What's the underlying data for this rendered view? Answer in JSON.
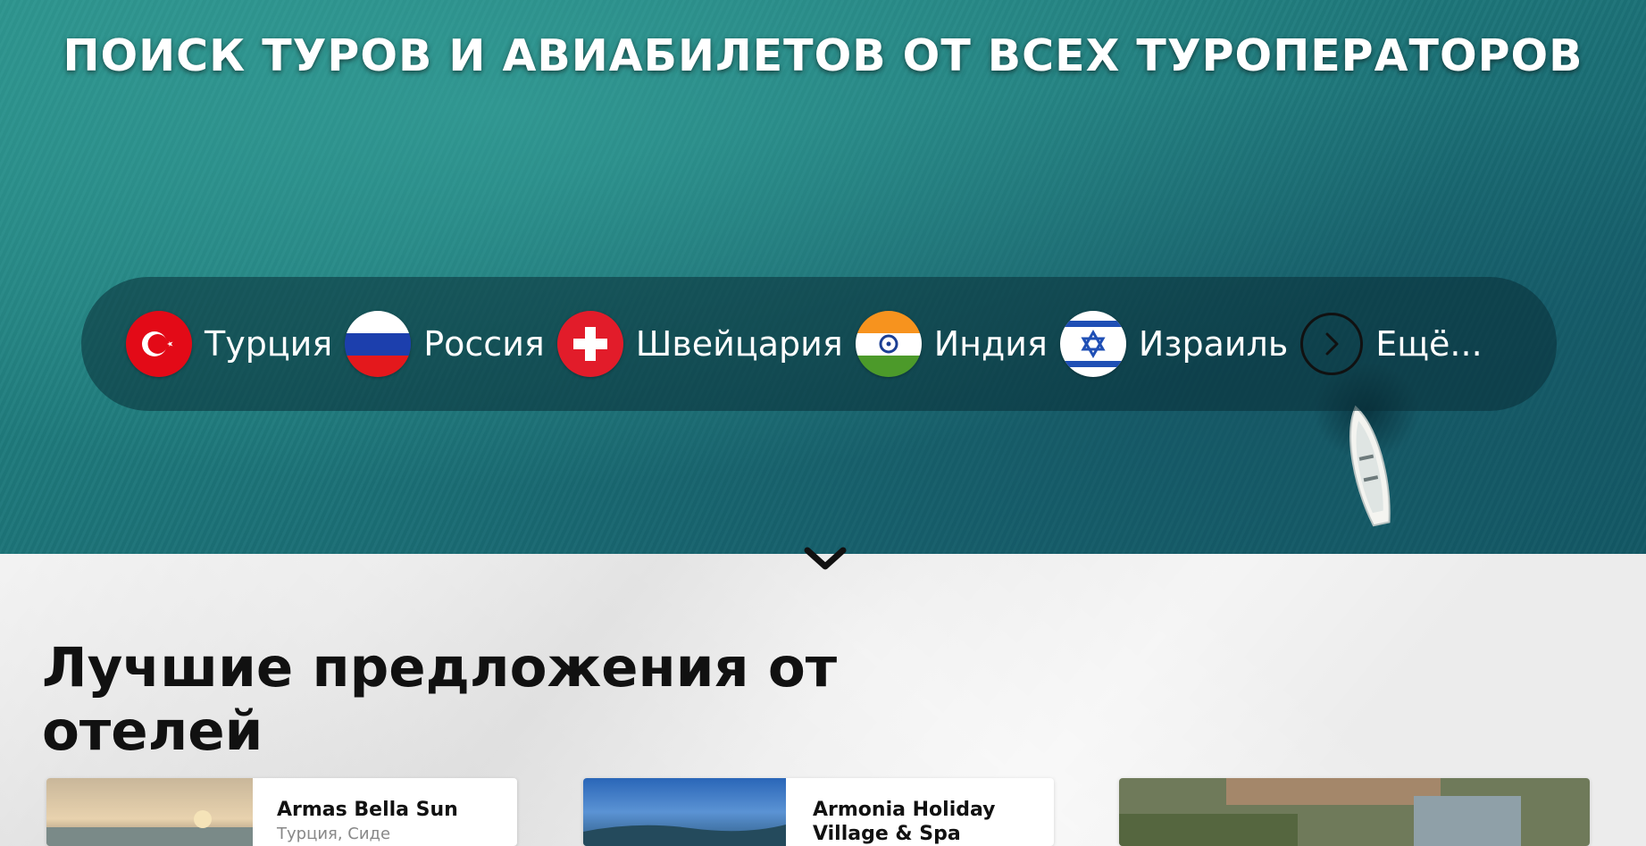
{
  "hero": {
    "title": "ПОИСК ТУРОВ И АВИАБИЛЕТОВ ОТ ВСЕХ ТУРОПЕРАТОРОВ"
  },
  "countries": [
    {
      "label": "Турция",
      "flag_icon": "turkey-flag-icon"
    },
    {
      "label": "Россия",
      "flag_icon": "russia-flag-icon"
    },
    {
      "label": "Швейцария",
      "flag_icon": "switzerland-flag-icon"
    },
    {
      "label": "Индия",
      "flag_icon": "india-flag-icon"
    },
    {
      "label": "Израиль",
      "flag_icon": "israel-flag-icon"
    }
  ],
  "more": {
    "label": "Ещё...",
    "icon": "chevron-right-icon"
  },
  "section": {
    "title": "Лучшие предложения от отелей"
  },
  "cards": [
    {
      "name": "Armas Bella Sun",
      "location": "Турция, Сиде"
    },
    {
      "name": "Armonia Holiday Village & Spa",
      "location": ""
    },
    {
      "name": "",
      "location": ""
    }
  ],
  "colors": {
    "hero_sea": "#1f7a7c",
    "bar_overlay": "rgba(10,45,55,0.55)",
    "text_dark": "#111111"
  }
}
